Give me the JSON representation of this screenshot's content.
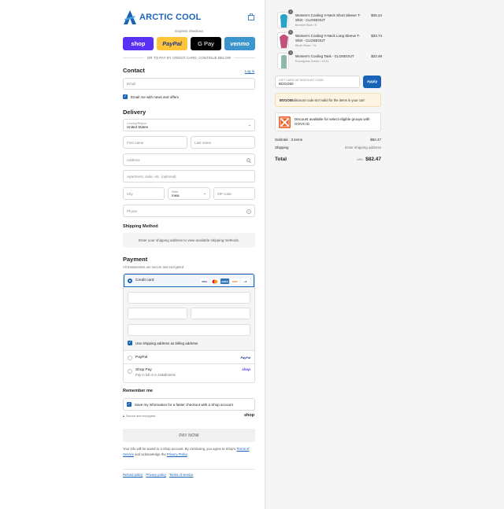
{
  "brand": {
    "name": "ARCTIC COOL",
    "color": "#1a64b8"
  },
  "express": {
    "label": "Express checkout",
    "buttons": [
      "shop",
      "PayPal",
      "G Pay",
      "venmo"
    ],
    "or_label": "OR TO PAY BY CREDIT CARD, CONTINUE BELOW"
  },
  "contact": {
    "title": "Contact",
    "login": "Log in",
    "email_placeholder": "Email",
    "newsletter": "Email me with news and offers"
  },
  "delivery": {
    "title": "Delivery",
    "country_label": "Country/Region",
    "country_value": "United States",
    "first_name": "First name",
    "last_name": "Last name",
    "address": "Address",
    "apartment": "Apartment, suite, etc. (optional)",
    "city": "City",
    "state_label": "State",
    "state_value": "Iowa",
    "zip": "ZIP code",
    "phone": "Phone"
  },
  "shipping_method": {
    "title": "Shipping Method",
    "info": "Enter your shipping address to view available shipping methods."
  },
  "payment": {
    "title": "Payment",
    "subtitle": "All transactions are secure and encrypted.",
    "credit_card": "Credit card",
    "card_brands": [
      "VISA",
      "MC",
      "AMEX",
      "DISC",
      "+4"
    ],
    "billing_same": "Use shipping address as billing address",
    "paypal": "PayPal",
    "paypal_brand": "PayPal",
    "shop_pay": "Shop Pay",
    "shop_pay_sub": "Pay in full or in installments",
    "shop_brand": "shop"
  },
  "remember": {
    "title": "Remember me",
    "save": "Save my information for a faster checkout with a Shop account",
    "secure": "Secure and encrypted",
    "shop_brand": "shop"
  },
  "pay_now": "PAY NOW",
  "legal": {
    "text_a": "Your info will be saved to a Shop account. By continuing, you agree to Shop's ",
    "terms": "Terms of Service",
    "text_b": " and acknowledge the ",
    "privacy": "Privacy Policy",
    "text_c": "."
  },
  "footer_links": [
    "Refund policy",
    "Privacy policy",
    "Terms of service"
  ],
  "cart": {
    "items": [
      {
        "name": "Women's Cooling V-Neck Short Sleeve T-Shirt - CLOSEOUT",
        "variant": "Bonaire Blue / S",
        "price": "$26.24",
        "qty": "1",
        "color": "#2aa1c9"
      },
      {
        "name": "Women's Cooling V-Neck Long Sleeve T-Shirt - CLOSEOUT",
        "variant": "Blush Rose / XL",
        "price": "$33.74",
        "qty": "1",
        "color": "#c2507d"
      },
      {
        "name": "Women's Cooling Tank - CLOSEOUT",
        "variant": "Eucalyptus Green / XXXL",
        "price": "$22.49",
        "qty": "1",
        "color": "#8fb8a8"
      }
    ],
    "discount_label": "GIFT CARD OR DISCOUNT CODE",
    "discount_value": "BOGO50",
    "apply": "Apply",
    "error_code": "BOGO50",
    "error_msg": " discount code isn't valid for the items in your cart",
    "govx": "Discount available for select eligible groups with GOVX ID",
    "subtotal_label": "Subtotal · 3 items",
    "subtotal": "$82.47",
    "shipping_label": "Shipping",
    "shipping_value": "Enter shipping address",
    "total_label": "Total",
    "currency": "USD",
    "total": "$82.47"
  }
}
